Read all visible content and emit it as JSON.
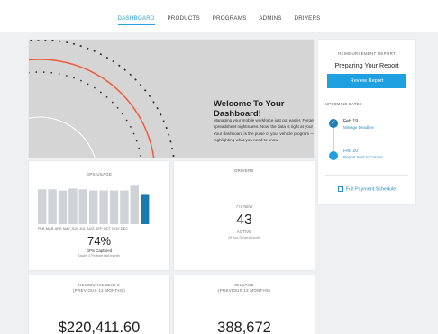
{
  "nav": {
    "items": [
      {
        "label": "DASHBOARD",
        "active": true
      },
      {
        "label": "PRODUCTS",
        "active": false
      },
      {
        "label": "PROGRAMS",
        "active": false
      },
      {
        "label": "ADMINS",
        "active": false
      },
      {
        "label": "DRIVERS",
        "active": false
      }
    ]
  },
  "welcome": {
    "title": "Welcome To Your Dashboard!",
    "body": "Managing your mobile workforce just got easier. Forget spreadsheet nightmares. Now, the data is right at your fingertips. Your dashboard is the pulse of your vehicle program — quickly highlighting what you need to know."
  },
  "report": {
    "header": "REIMBURSEMENT REPORT",
    "status": "Preparing Your Report",
    "button_label": "Review Report",
    "upcoming_label": "UPCOMING DATES",
    "events": [
      {
        "date": "Feb 19",
        "label": "Mileage Deadline",
        "done": true
      },
      {
        "date": "Feb 20",
        "label": "Report Sent to Concur",
        "done": false
      }
    ],
    "schedule_link": "Full Payment Schedule"
  },
  "gps": {
    "title": "GPS USAGE",
    "value": "74%",
    "caption": "GPS Captured",
    "note": "Down 17% from last month"
  },
  "chart_data": {
    "type": "bar",
    "categories": [
      "FEB",
      "MAR",
      "APR",
      "MAY",
      "JUN",
      "JUL",
      "AUG",
      "SEP",
      "OCT",
      "NOV",
      "DEC",
      ""
    ],
    "values": [
      88,
      88,
      85,
      90,
      88,
      85,
      85,
      85,
      85,
      97,
      74,
      0
    ],
    "highlight_index": 10,
    "bar_color": "#cfd2d6",
    "highlight_color": "#1a79b0",
    "ylim": [
      0,
      100
    ]
  },
  "drivers": {
    "title": "DRIVERS",
    "new_label": "7 IS NEW",
    "count": "43",
    "active_label": "ACTIVE",
    "note": "25 Avg Drivers/Month"
  },
  "reimbursements": {
    "title_line1": "REIMBURSEMENTS",
    "title_line2": "(PREVIOUS 12 MONTHS)",
    "value": "$220,411.60"
  },
  "mileage": {
    "title_line1": "MILEAGE",
    "title_line2": "(PREVIOUS 12 MONTHS)",
    "value": "388,672"
  },
  "colors": {
    "accent": "#1fa0e0",
    "arc_orange": "#f05a3a"
  }
}
